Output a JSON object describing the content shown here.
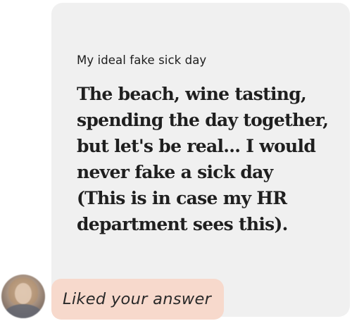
{
  "prompt": {
    "question": "My ideal fake sick day",
    "answer": "The beach, wine tasting,\nspending the day together,\nbut let's be real... I would\nnever fake a sick day\n(This is in case my HR\ndepartment sees this)."
  },
  "reply": {
    "text": "Liked your answer"
  },
  "colors": {
    "card_background": "#f0f0f0",
    "reply_background": "#f7d9cc",
    "text": "#1f1f1f"
  }
}
